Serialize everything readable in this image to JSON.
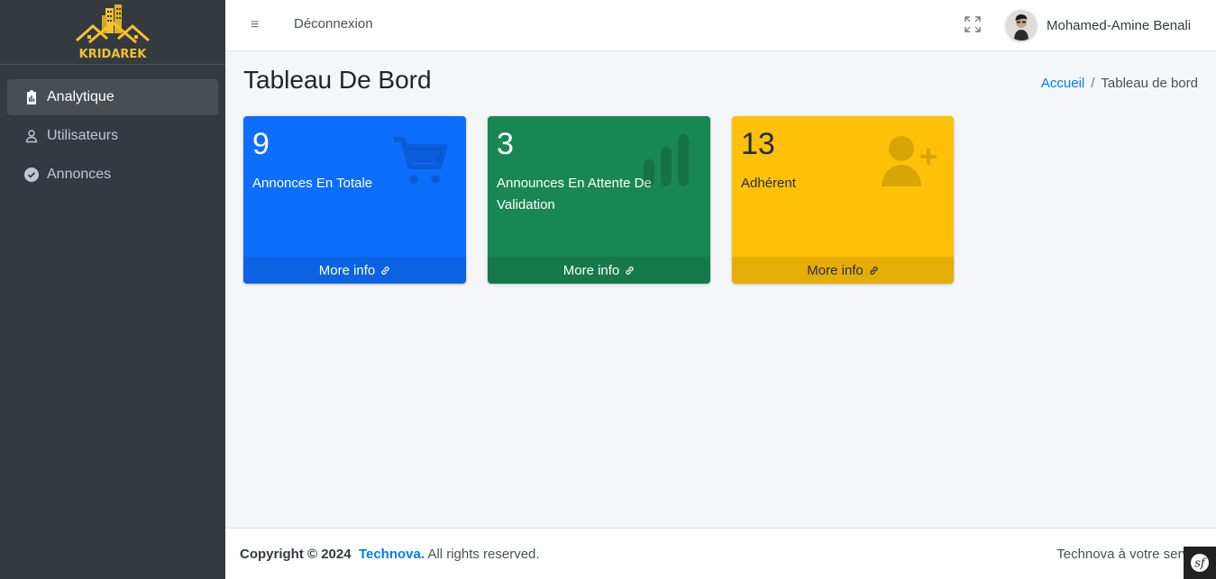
{
  "brand": {
    "logo_text": "KRIDAREK"
  },
  "sidebar": {
    "items": [
      {
        "label": "Analytique",
        "icon": "clipboard-icon",
        "active": true
      },
      {
        "label": "Utilisateurs",
        "icon": "user-icon",
        "active": false
      },
      {
        "label": "Annonces",
        "icon": "check-circle-icon",
        "active": false
      }
    ]
  },
  "topbar": {
    "logout_label": "Déconnexion",
    "user_name": "Mohamed-Amine Benali"
  },
  "page": {
    "title": "Tableau De Bord",
    "breadcrumb": {
      "home": "Accueil",
      "separator": "/",
      "current": "Tableau de bord"
    }
  },
  "boxes": [
    {
      "value": "9",
      "label": "Annonces En Totale",
      "more": "More info",
      "icon": "shopping-cart-icon",
      "color": "#0d6efd"
    },
    {
      "value": "3",
      "label": "Announces En Attente De Validation",
      "more": "More info",
      "icon": "bar-chart-icon",
      "color": "#198754"
    },
    {
      "value": "13",
      "label": "Adhérent",
      "more": "More info",
      "icon": "user-plus-icon",
      "color": "#ffc107"
    }
  ],
  "footer": {
    "copyright": "Copyright © 2024",
    "company": "Technova.",
    "rights": "All rights reserved.",
    "right_text": "Technova à votre serv"
  }
}
